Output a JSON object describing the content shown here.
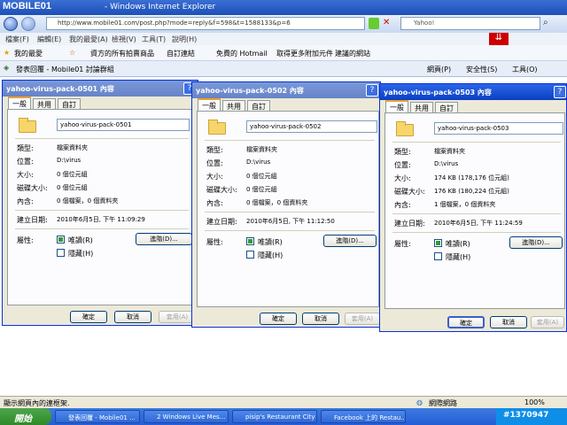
{
  "browser": {
    "logo_text": "MOBILE01",
    "window_title": "- Windows Internet Explorer",
    "address": "http://www.mobile01.com/post.php?mode=reply&f=598&t=1588133&p=6",
    "search_placeholder": "Yahoo!",
    "menu": [
      "檔案(F)",
      "編輯(E)",
      "我的最愛(A)",
      "檢視(V)",
      "工具(T)",
      "說明(H)"
    ],
    "favorites_label": "我的最愛",
    "favorites_links": [
      "資方的所有拍賣商品",
      "自訂連結",
      "免費的 Hotmail",
      "取得更多附加元件",
      "建議的網站"
    ],
    "tab_title": "發表回覆 - Mobile01 討論群組",
    "toolbar_right": [
      "網頁(P)",
      "安全性(S)",
      "工具(O)"
    ],
    "status_left": "顯示網頁內的連框架.",
    "status_zone": "網際網路",
    "zoom": "100%"
  },
  "taskbar": {
    "start_label": "開始",
    "items": [
      "發表回覆 - Mobile01 ...",
      "2 Windows Live Mes...",
      "pisip's Restaurant City ...",
      "Facebook 上的 Restau..."
    ],
    "tray_text": "#1370947"
  },
  "dialogs": [
    {
      "title": "yahoo-virus-pack-0501 內容",
      "tabs": [
        "一般",
        "共用",
        "自訂"
      ],
      "name": "yahoo-virus-pack-0501",
      "type_label": "類型:",
      "type_value": "檔案資料夾",
      "location_label": "位置:",
      "location_value": "D:\\virus",
      "size_label": "大小:",
      "size_value": "0 個位元組",
      "disk_label": "磁碟大小:",
      "disk_value": "0 個位元組",
      "contains_label": "內含:",
      "contains_value": "0 個檔案，0 個資料夾",
      "created_label": "建立日期:",
      "created_value": "2010年6月5日, 下午 11:09:29",
      "attr_label": "屬性:",
      "readonly_label": "唯讀(R)",
      "hidden_label": "隱藏(H)",
      "advanced_label": "進階(D)...",
      "ok": "確定",
      "cancel": "取消",
      "apply": "套用(A)"
    },
    {
      "title": "yahoo-virus-pack-0502 內容",
      "tabs": [
        "一般",
        "共用",
        "自訂"
      ],
      "name": "yahoo-virus-pack-0502",
      "type_label": "類型:",
      "type_value": "檔案資料夾",
      "location_label": "位置:",
      "location_value": "D:\\virus",
      "size_label": "大小:",
      "size_value": "0 個位元組",
      "disk_label": "磁碟大小:",
      "disk_value": "0 個位元組",
      "contains_label": "內含:",
      "contains_value": "0 個檔案，0 個資料夾",
      "created_label": "建立日期:",
      "created_value": "2010年6月5日, 下午 11:12:50",
      "attr_label": "屬性:",
      "readonly_label": "唯讀(R)",
      "hidden_label": "隱藏(H)",
      "advanced_label": "進階(D)...",
      "ok": "確定",
      "cancel": "取消",
      "apply": "套用(A)"
    },
    {
      "title": "yahoo-virus-pack-0503 內容",
      "tabs": [
        "一般",
        "共用",
        "自訂"
      ],
      "name": "yahoo-virus-pack-0503",
      "type_label": "類型:",
      "type_value": "檔案資料夾",
      "location_label": "位置:",
      "location_value": "D:\\virus",
      "size_label": "大小:",
      "size_value": "174 KB (178,176 位元組)",
      "disk_label": "磁碟大小:",
      "disk_value": "176 KB (180,224 位元組)",
      "contains_label": "內含:",
      "contains_value": "1 個檔案，0 個資料夾",
      "created_label": "建立日期:",
      "created_value": "2010年6月5日, 下午 11:24:59",
      "attr_label": "屬性:",
      "readonly_label": "唯讀(R)",
      "hidden_label": "隱藏(H)",
      "advanced_label": "進階(D)...",
      "ok": "確定",
      "cancel": "取消",
      "apply": "套用(A)"
    }
  ]
}
